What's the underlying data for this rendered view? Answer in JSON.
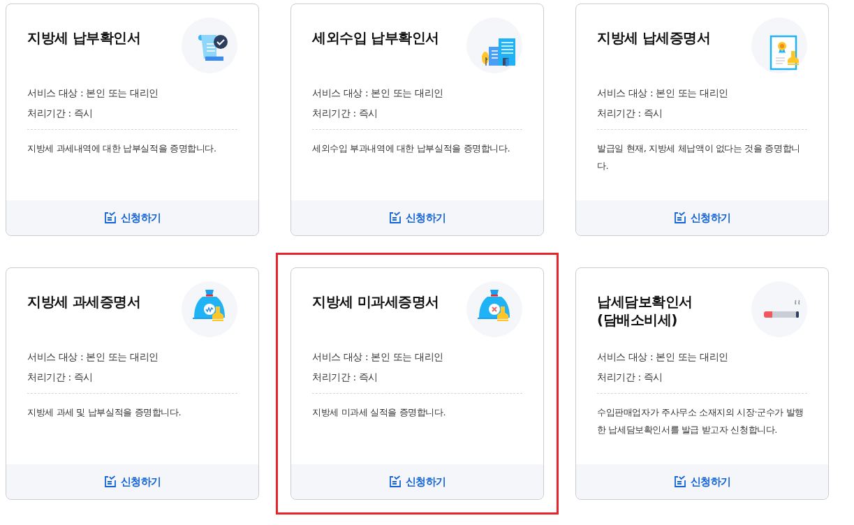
{
  "cards": [
    {
      "title": "지방세 납부확인서",
      "kind": "scroll",
      "target": "서비스 대상 : 본인 또는 대리인",
      "period": "처리기간 : 즉시",
      "description": "지방세 과세내역에 대한 납부실적을 증명합니다.",
      "button": "신청하기",
      "highlighted": false
    },
    {
      "title": "세외수입 납부확인서",
      "kind": "buildings",
      "target": "서비스 대상 : 본인 또는 대리인",
      "period": "처리기간 : 즉시",
      "description": "세외수입 부과내역에 대한 납부실적을 증명합니다.",
      "button": "신청하기",
      "highlighted": false
    },
    {
      "title": "지방세 납세증명서",
      "kind": "certificate",
      "target": "서비스 대상 : 본인 또는 대리인",
      "period": "처리기간 : 즉시",
      "description": "발급일 현재, 지방세 체납액이 없다는 것을 증명합니다.",
      "button": "신청하기",
      "highlighted": false
    },
    {
      "title": "지방세 과세증명서",
      "kind": "moneybag-won",
      "target": "서비스 대상 : 본인 또는 대리인",
      "period": "처리기간 : 즉시",
      "description": "지방세 과세 및 납부실적을 증명합니다.",
      "button": "신청하기",
      "highlighted": false
    },
    {
      "title": "지방세 미과세증명서",
      "kind": "moneybag-x",
      "target": "서비스 대상 : 본인 또는 대리인",
      "period": "처리기간 : 즉시",
      "description": "지방세 미과세 실적을 증명합니다.",
      "button": "신청하기",
      "highlighted": true
    },
    {
      "title": "납세담보확인서 (담배소비세)",
      "kind": "cigarette",
      "target": "서비스 대상 : 본인 또는 대리인",
      "period": "처리기간 : 즉시",
      "description": "수입판매업자가 주사무소 소재지의 시장·군수가 발행한 납세담보확인서를 발급 받고자 신청합니다.",
      "button": "신청하기",
      "highlighted": false
    }
  ]
}
